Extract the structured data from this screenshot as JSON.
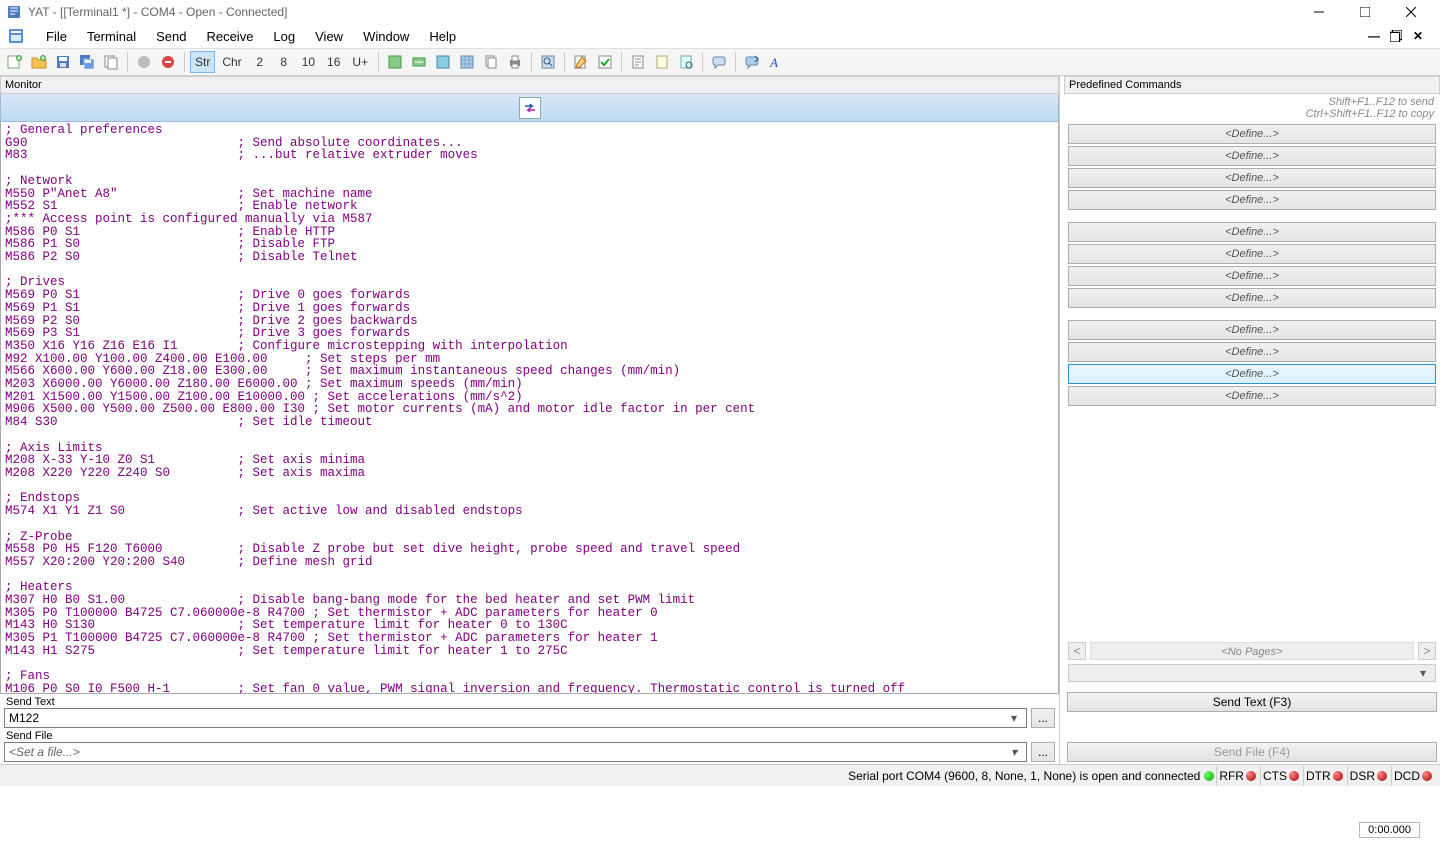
{
  "window": {
    "title": "YAT - [[Terminal1 *] - COM4 - Open - Connected]"
  },
  "menu": {
    "items": [
      "File",
      "Terminal",
      "Send",
      "Receive",
      "Log",
      "View",
      "Window",
      "Help"
    ]
  },
  "toolbar": {
    "radix_buttons": [
      "Str",
      "Chr",
      "2",
      "8",
      "10",
      "16",
      "U+"
    ],
    "active_radix": "Str"
  },
  "monitor": {
    "label": "Monitor",
    "content": "; General preferences\nG90                            ; Send absolute coordinates...\nM83                            ; ...but relative extruder moves\n\n; Network\nM550 P\"Anet A8\"                ; Set machine name\nM552 S1                        ; Enable network\n;*** Access point is configured manually via M587\nM586 P0 S1                     ; Enable HTTP\nM586 P1 S0                     ; Disable FTP\nM586 P2 S0                     ; Disable Telnet\n\n; Drives\nM569 P0 S1                     ; Drive 0 goes forwards\nM569 P1 S1                     ; Drive 1 goes forwards\nM569 P2 S0                     ; Drive 2 goes backwards\nM569 P3 S1                     ; Drive 3 goes forwards\nM350 X16 Y16 Z16 E16 I1        ; Configure microstepping with interpolation\nM92 X100.00 Y100.00 Z400.00 E100.00     ; Set steps per mm\nM566 X600.00 Y600.00 Z18.00 E300.00     ; Set maximum instantaneous speed changes (mm/min)\nM203 X6000.00 Y6000.00 Z180.00 E6000.00 ; Set maximum speeds (mm/min)\nM201 X1500.00 Y1500.00 Z100.00 E10000.00 ; Set accelerations (mm/s^2)\nM906 X500.00 Y500.00 Z500.00 E800.00 I30 ; Set motor currents (mA) and motor idle factor in per cent\nM84 S30                        ; Set idle timeout\n\n; Axis Limits\nM208 X-33 Y-10 Z0 S1           ; Set axis minima\nM208 X220 Y220 Z240 S0         ; Set axis maxima\n\n; Endstops\nM574 X1 Y1 Z1 S0               ; Set active low and disabled endstops\n\n; Z-Probe\nM558 P0 H5 F120 T6000          ; Disable Z probe but set dive height, probe speed and travel speed\nM557 X20:200 Y20:200 S40       ; Define mesh grid\n\n; Heaters\nM307 H0 B0 S1.00               ; Disable bang-bang mode for the bed heater and set PWM limit\nM305 P0 T100000 B4725 C7.060000e-8 R4700 ; Set thermistor + ADC parameters for heater 0\nM143 H0 S130                   ; Set temperature limit for heater 0 to 130C\nM305 P1 T100000 B4725 C7.060000e-8 R4700 ; Set thermistor + ADC parameters for heater 1\nM143 H1 S275                   ; Set temperature limit for heater 1 to 275C\n\n; Fans\nM106 P0 S0 I0 F500 H-1         ; Set fan 0 value, PWM signal inversion and frequency. Thermostatic control is turned off"
  },
  "predefined": {
    "label": "Predefined Commands",
    "hint1": "Shift+F1..F12 to send",
    "hint2": "Ctrl+Shift+F1..F12 to copy",
    "define_label": "<Define...>",
    "no_pages": "<No Pages>",
    "group1_count": 4,
    "group2_count": 4,
    "group3_count": 4,
    "highlighted_index": 10
  },
  "send_text": {
    "label": "Send Text",
    "value": "M122",
    "button": "Send Text (F3)"
  },
  "send_file": {
    "label": "Send File",
    "placeholder": "<Set a file...>",
    "button": "Send File (F4)"
  },
  "status": {
    "text": "Serial port COM4 (9600, 8, None, 1, None) is open and connected",
    "connection_led": "green",
    "signals": [
      {
        "name": "RFR",
        "led": "red"
      },
      {
        "name": "CTS",
        "led": "red"
      },
      {
        "name": "DTR",
        "led": "red"
      },
      {
        "name": "DSR",
        "led": "red"
      },
      {
        "name": "DCD",
        "led": "red"
      }
    ]
  },
  "timer": "0:00.000"
}
